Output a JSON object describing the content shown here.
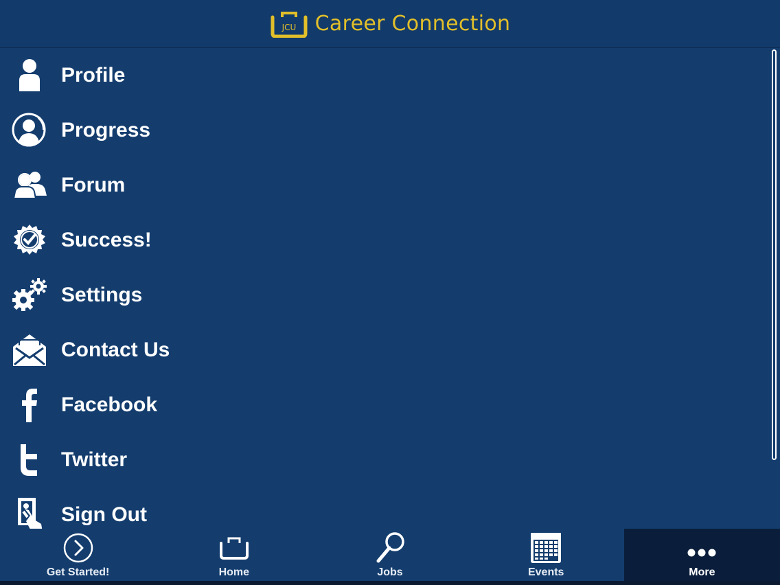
{
  "header": {
    "logo_text": "JCU",
    "title": "Career Connection",
    "accent_color": "#e2bf2a"
  },
  "menu": {
    "items": [
      {
        "label": "Profile",
        "icon": "person-icon"
      },
      {
        "label": "Progress",
        "icon": "progress-icon"
      },
      {
        "label": "Forum",
        "icon": "people-icon"
      },
      {
        "label": "Success!",
        "icon": "success-badge-icon"
      },
      {
        "label": "Settings",
        "icon": "gears-icon"
      },
      {
        "label": "Contact Us",
        "icon": "envelope-icon"
      },
      {
        "label": "Facebook",
        "icon": "facebook-icon"
      },
      {
        "label": "Twitter",
        "icon": "twitter-icon"
      },
      {
        "label": "Sign Out",
        "icon": "sign-out-icon"
      }
    ]
  },
  "tabbar": {
    "tabs": [
      {
        "label": "Get Started!",
        "icon": "play-circle-icon"
      },
      {
        "label": "Home",
        "icon": "briefcase-icon"
      },
      {
        "label": "Jobs",
        "icon": "magnifier-icon"
      },
      {
        "label": "Events",
        "icon": "calendar-icon"
      },
      {
        "label": "More",
        "icon": "more-dots-icon",
        "active": true
      }
    ]
  },
  "colors": {
    "background": "#143d6e",
    "active_tab": "#0a1e3b"
  }
}
